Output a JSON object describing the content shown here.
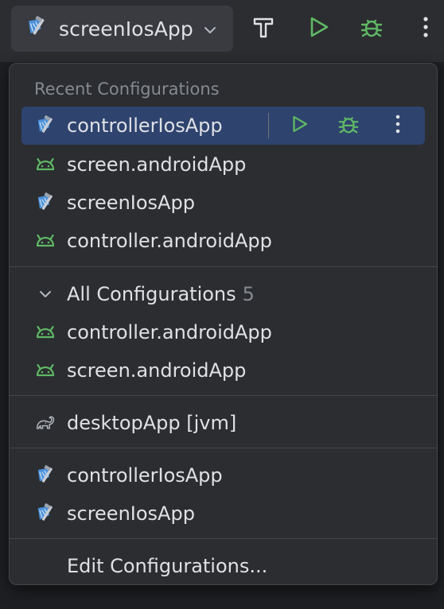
{
  "toolbar": {
    "selected_config": "screenIosApp",
    "build_icon": "hammer-icon",
    "run_icon": "run-icon",
    "debug_icon": "debug-icon",
    "more_icon": "more-vertical-icon"
  },
  "popup": {
    "recent_title": "Recent Configurations",
    "recent": [
      {
        "label": "controllerIosApp",
        "icon": "xcode-icon",
        "selected": true
      },
      {
        "label": "screen.androidApp",
        "icon": "android-icon"
      },
      {
        "label": "screenIosApp",
        "icon": "xcode-icon"
      },
      {
        "label": "controller.androidApp",
        "icon": "android-icon"
      }
    ],
    "all": {
      "label": "All Configurations",
      "count": "5",
      "items": [
        {
          "label": "controller.androidApp",
          "icon": "android-icon"
        },
        {
          "label": "screen.androidApp",
          "icon": "android-icon"
        }
      ]
    },
    "desktop": {
      "label": "desktopApp [jvm]",
      "icon": "gradle-icon"
    },
    "ios": [
      {
        "label": "controllerIosApp",
        "icon": "xcode-icon"
      },
      {
        "label": "screenIosApp",
        "icon": "xcode-icon"
      }
    ],
    "edit_label": "Edit Configurations..."
  },
  "colors": {
    "background": "#1e1f22",
    "popup_bg": "#2b2d30",
    "selection": "#2e436e",
    "run_green": "#5fb865",
    "android_green": "#5fb865",
    "text": "#dfe1e5",
    "muted": "#868a91"
  }
}
